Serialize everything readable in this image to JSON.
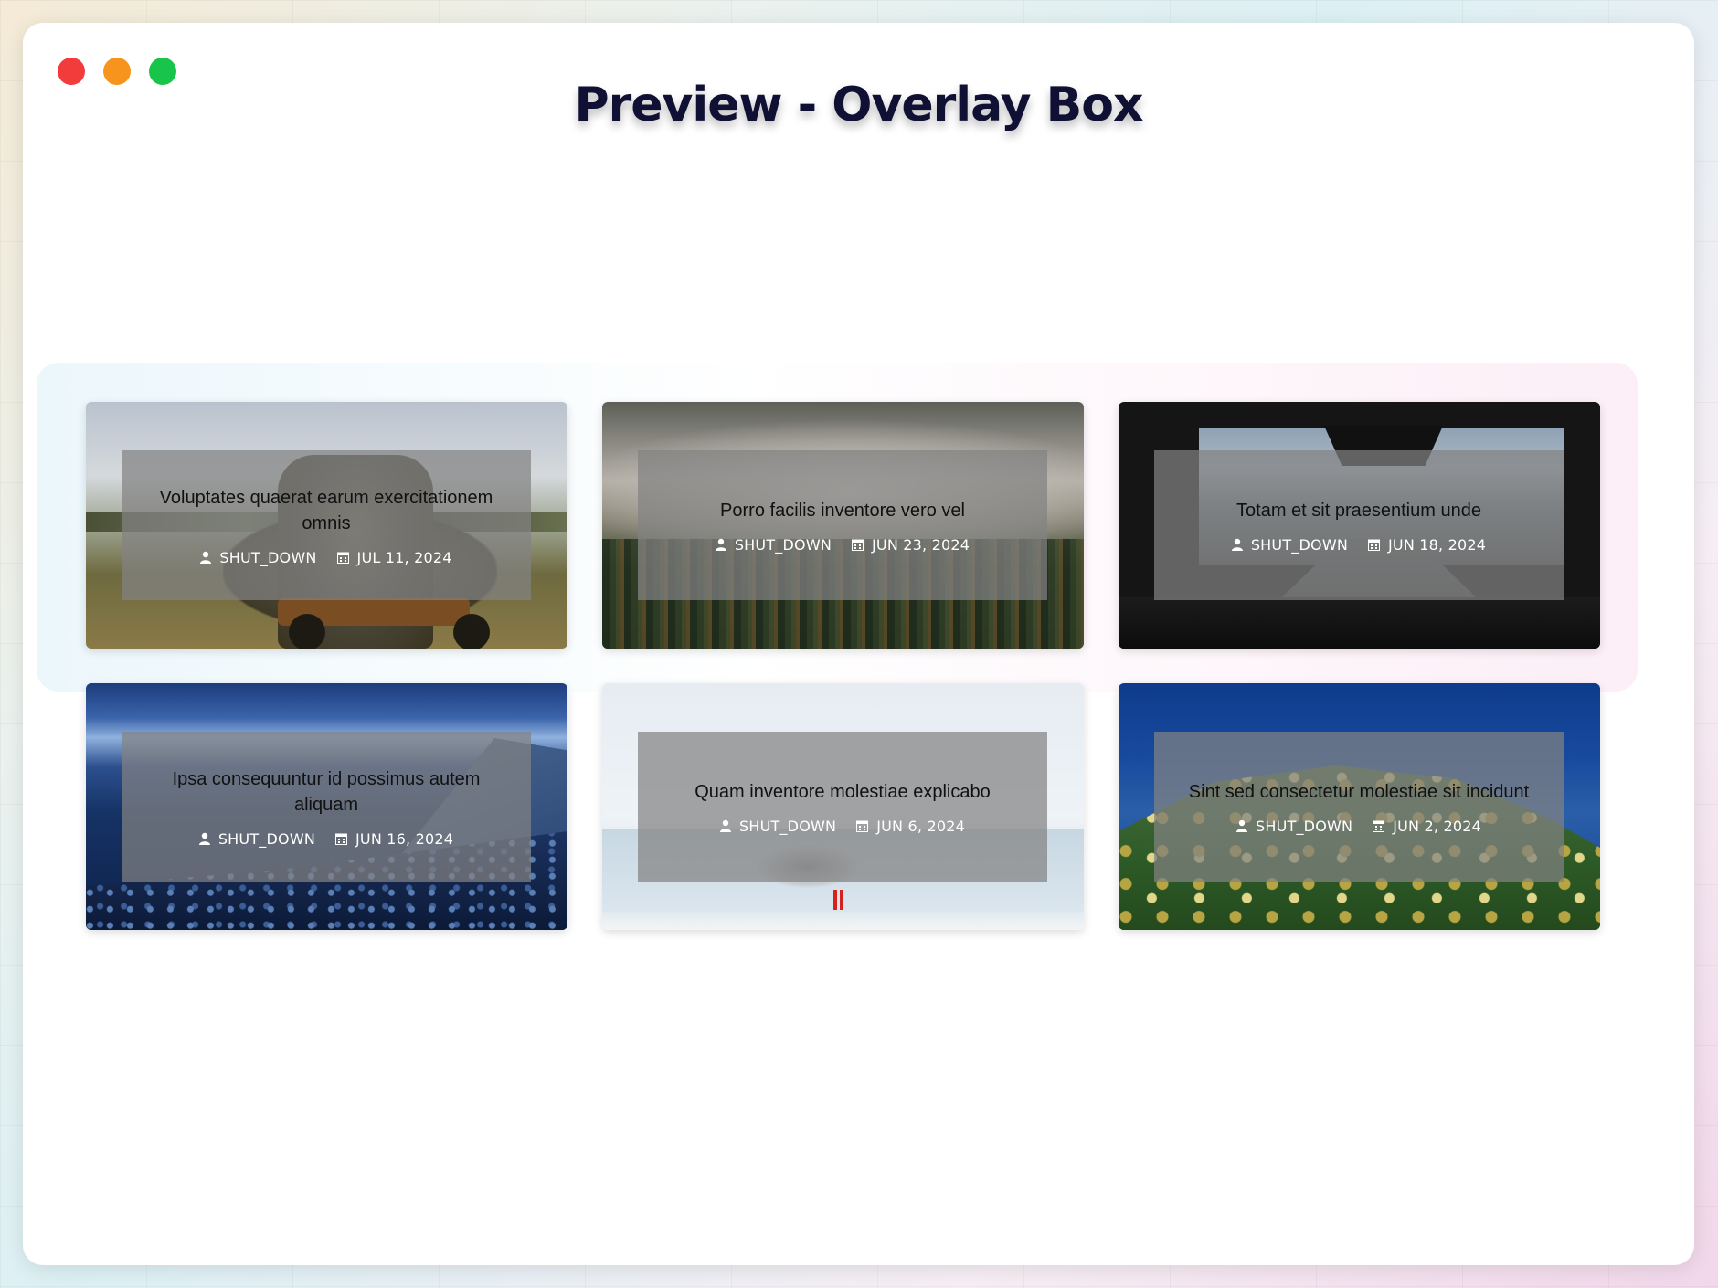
{
  "page": {
    "title": "Preview - Overlay Box"
  },
  "window_controls": [
    {
      "name": "close",
      "color": "#f23c3c"
    },
    {
      "name": "minimize",
      "color": "#f7941d"
    },
    {
      "name": "zoom",
      "color": "#19c44a"
    }
  ],
  "posts": [
    {
      "title": "Voluptates quaerat earum exercitationem omnis",
      "author": "SHUT_DOWN",
      "date": "JUL 11, 2024"
    },
    {
      "title": "Porro facilis inventore vero vel",
      "author": "SHUT_DOWN",
      "date": "JUN 23, 2024"
    },
    {
      "title": "Totam et sit praesentium unde",
      "author": "SHUT_DOWN",
      "date": "JUN 18, 2024"
    },
    {
      "title": "Ipsa consequuntur id possimus autem aliquam",
      "author": "SHUT_DOWN",
      "date": "JUN 16, 2024"
    },
    {
      "title": "Quam inventore molestiae explicabo",
      "author": "SHUT_DOWN",
      "date": "JUN 6, 2024"
    },
    {
      "title": "Sint sed consectetur molestiae sit incidunt",
      "author": "SHUT_DOWN",
      "date": "JUN 2, 2024"
    }
  ],
  "icons": {
    "author": "user-icon",
    "date": "calendar-icon"
  }
}
